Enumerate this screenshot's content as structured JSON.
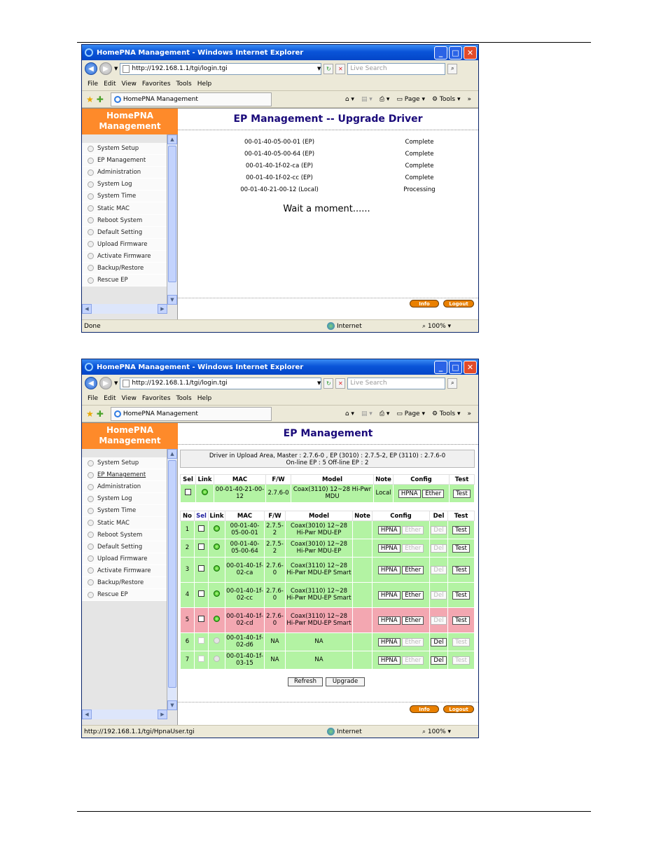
{
  "window": {
    "title": "HomePNA Management - Windows Internet Explorer",
    "url": "http://192.168.1.1/tgi/login.tgi",
    "search_placeholder": "Live Search",
    "tab_title": "HomePNA Management",
    "menu": [
      "File",
      "Edit",
      "View",
      "Favorites",
      "Tools",
      "Help"
    ],
    "page_label": "Page",
    "tools_label": "Tools",
    "zone": "Internet",
    "zoom": "100%"
  },
  "sidebar": {
    "brand_line1": "HomePNA",
    "brand_line2": "Management",
    "items": [
      "System Setup",
      "EP Management",
      "Administration",
      "System Log",
      "System Time",
      "Static MAC",
      "Reboot System",
      "Default Setting",
      "Upload Firmware",
      "Activate Firmware",
      "Backup/Restore",
      "Rescue EP"
    ]
  },
  "footer_buttons": {
    "info": "Info",
    "logout": "Logout"
  },
  "upgrade_page": {
    "title": "EP Management -- Upgrade Driver",
    "rows": [
      {
        "mac": "00-01-40-05-00-01 (EP)",
        "status": "Complete"
      },
      {
        "mac": "00-01-40-05-00-64 (EP)",
        "status": "Complete"
      },
      {
        "mac": "00-01-40-1f-02-ca (EP)",
        "status": "Complete"
      },
      {
        "mac": "00-01-40-1f-02-cc (EP)",
        "status": "Complete"
      },
      {
        "mac": "00-01-40-21-00-12 (Local)",
        "status": "Processing"
      }
    ],
    "wait_text": "Wait a moment......",
    "status_text": "Done"
  },
  "ep_page": {
    "title": "EP Management",
    "info_line1": "Driver in Upload Area, Master : 2.7.6-0 ,  EP (3010) : 2.7.5-2,  EP (3110) : 2.7.6-0",
    "info_line2": "On-line EP : 5    Off-line EP : 2",
    "master_headers": [
      "Sel",
      "Link",
      "MAC",
      "F/W",
      "Model",
      "Note",
      "Config",
      "Test"
    ],
    "master": {
      "mac": "00-01-40-21-00-12",
      "fw": "2.7.6-0",
      "model": "Coax(3110) 12~28 Hi-Pwr MDU",
      "note": "Local",
      "hpna": "HPNA",
      "ether": "Ether",
      "test": "Test"
    },
    "ep_headers": [
      "No",
      "Sel",
      "Link",
      "MAC",
      "F/W",
      "Model",
      "Note",
      "Config",
      "Del",
      "Test"
    ],
    "eps": [
      {
        "no": "1",
        "mac": "00-01-40-05-00-01",
        "fw": "2.7.5-2",
        "model": "Coax(3010) 12~28 Hi-Pwr MDU-EP",
        "online": true,
        "color": "green",
        "ether_enabled": false,
        "del_enabled": false,
        "test_enabled": true
      },
      {
        "no": "2",
        "mac": "00-01-40-05-00-64",
        "fw": "2.7.5-2",
        "model": "Coax(3010) 12~28 Hi-Pwr MDU-EP",
        "online": true,
        "color": "green",
        "ether_enabled": false,
        "del_enabled": false,
        "test_enabled": true
      },
      {
        "no": "3",
        "mac": "00-01-40-1f-02-ca",
        "fw": "2.7.6-0",
        "model": "Coax(3110) 12~28 Hi-Pwr MDU-EP Smart",
        "online": true,
        "color": "green",
        "ether_enabled": true,
        "del_enabled": false,
        "test_enabled": true
      },
      {
        "no": "4",
        "mac": "00-01-40-1f-02-cc",
        "fw": "2.7.6-0",
        "model": "Coax(3110) 12~28 Hi-Pwr MDU-EP Smart",
        "online": true,
        "color": "green",
        "ether_enabled": true,
        "del_enabled": false,
        "test_enabled": true
      },
      {
        "no": "5",
        "mac": "00-01-40-1f-02-cd",
        "fw": "2.7.6-0",
        "model": "Coax(3110) 12~28 Hi-Pwr MDU-EP Smart",
        "online": true,
        "color": "red",
        "ether_enabled": true,
        "del_enabled": false,
        "test_enabled": true
      },
      {
        "no": "6",
        "mac": "00-01-40-1f-02-d6",
        "fw": "NA",
        "model": "NA",
        "online": false,
        "color": "green",
        "ether_enabled": false,
        "del_enabled": true,
        "test_enabled": false
      },
      {
        "no": "7",
        "mac": "00-01-40-1f-03-15",
        "fw": "NA",
        "model": "NA",
        "online": false,
        "color": "green",
        "ether_enabled": false,
        "del_enabled": true,
        "test_enabled": false
      }
    ],
    "btn_hpna": "HPNA",
    "btn_ether": "Ether",
    "btn_del": "Del",
    "btn_test": "Test",
    "refresh": "Refresh",
    "upgrade": "Upgrade",
    "status_text": "http://192.168.1.1/tgi/HpnaUser.tgi"
  }
}
